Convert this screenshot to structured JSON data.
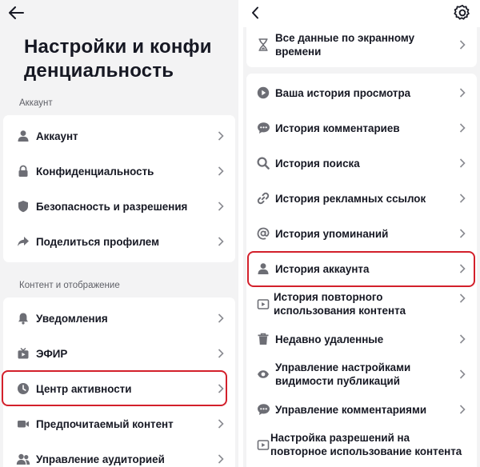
{
  "left": {
    "title": "Настройки и конфи денциальность",
    "sections": [
      {
        "label": "Аккаунт",
        "items": [
          {
            "label": "Аккаунт",
            "icon": "person-icon"
          },
          {
            "label": "Конфиденциальность",
            "icon": "lock-icon"
          },
          {
            "label": "Безопасность и разрешения",
            "icon": "shield-icon"
          },
          {
            "label": "Поделиться профилем",
            "icon": "share-icon"
          }
        ]
      },
      {
        "label": "Контент и отображение",
        "items": [
          {
            "label": "Уведомления",
            "icon": "bell-icon"
          },
          {
            "label": "ЭФИР",
            "icon": "tv-icon"
          },
          {
            "label": "Центр активности",
            "icon": "clock-icon",
            "highlighted": true
          },
          {
            "label": "Предпочитаемый контент",
            "icon": "video-camera-icon"
          },
          {
            "label": "Управление аудиторией",
            "icon": "people-icon"
          }
        ]
      }
    ]
  },
  "right": {
    "items_top": [
      {
        "label": "Все данные по экранному времени",
        "icon": "hourglass-icon"
      }
    ],
    "items": [
      {
        "label": "Ваша история просмотра",
        "icon": "play-icon"
      },
      {
        "label": "История комментариев",
        "icon": "comment-icon"
      },
      {
        "label": "История поиска",
        "icon": "search-icon"
      },
      {
        "label": "История рекламных ссылок",
        "icon": "link-icon"
      },
      {
        "label": "История упоминаний",
        "icon": "at-icon"
      },
      {
        "label": "История аккаунта",
        "icon": "person-icon",
        "highlighted": true
      },
      {
        "label": "История повторного использования контента",
        "icon": "repost-icon"
      },
      {
        "label": "Недавно удаленные",
        "icon": "trash-icon"
      },
      {
        "label": "Управление настройками видимости публикаций",
        "icon": "eye-icon"
      },
      {
        "label": "Управление комментариями",
        "icon": "comment-icon"
      },
      {
        "label": "Настройка разрешений на повторное использование контента",
        "icon": "repost-icon"
      }
    ]
  },
  "colors": {
    "highlight": "#d3202b",
    "background": "#f3f3f4",
    "card": "#ffffff",
    "text": "#161823"
  }
}
